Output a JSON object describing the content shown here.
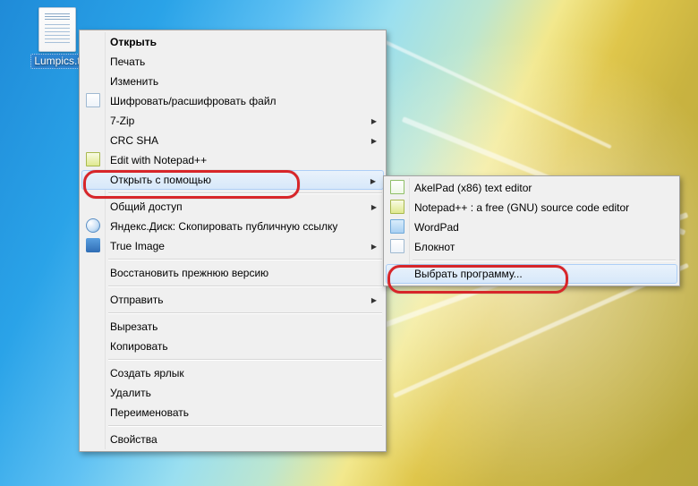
{
  "desktop": {
    "file_label": "Lumpics.t"
  },
  "menu": {
    "open": "Открыть",
    "print": "Печать",
    "edit": "Изменить",
    "encrypt": "Шифровать/расшифровать файл",
    "sevenzip": "7-Zip",
    "crcsha": "CRC SHA",
    "edit_npp": "Edit with Notepad++",
    "open_with": "Открыть с помощью",
    "share": "Общий доступ",
    "yadisk": "Яндекс.Диск: Скопировать публичную ссылку",
    "trueimage": "True Image",
    "restore": "Восстановить прежнюю версию",
    "send_to": "Отправить",
    "cut": "Вырезать",
    "copy": "Копировать",
    "shortcut": "Создать ярлык",
    "delete": "Удалить",
    "rename": "Переименовать",
    "properties": "Свойства"
  },
  "submenu": {
    "akelpad": "AkelPad (x86) text editor",
    "npp": "Notepad++ : a free (GNU) source code editor",
    "wordpad": "WordPad",
    "notepad": "Блокнот",
    "choose": "Выбрать программу..."
  }
}
